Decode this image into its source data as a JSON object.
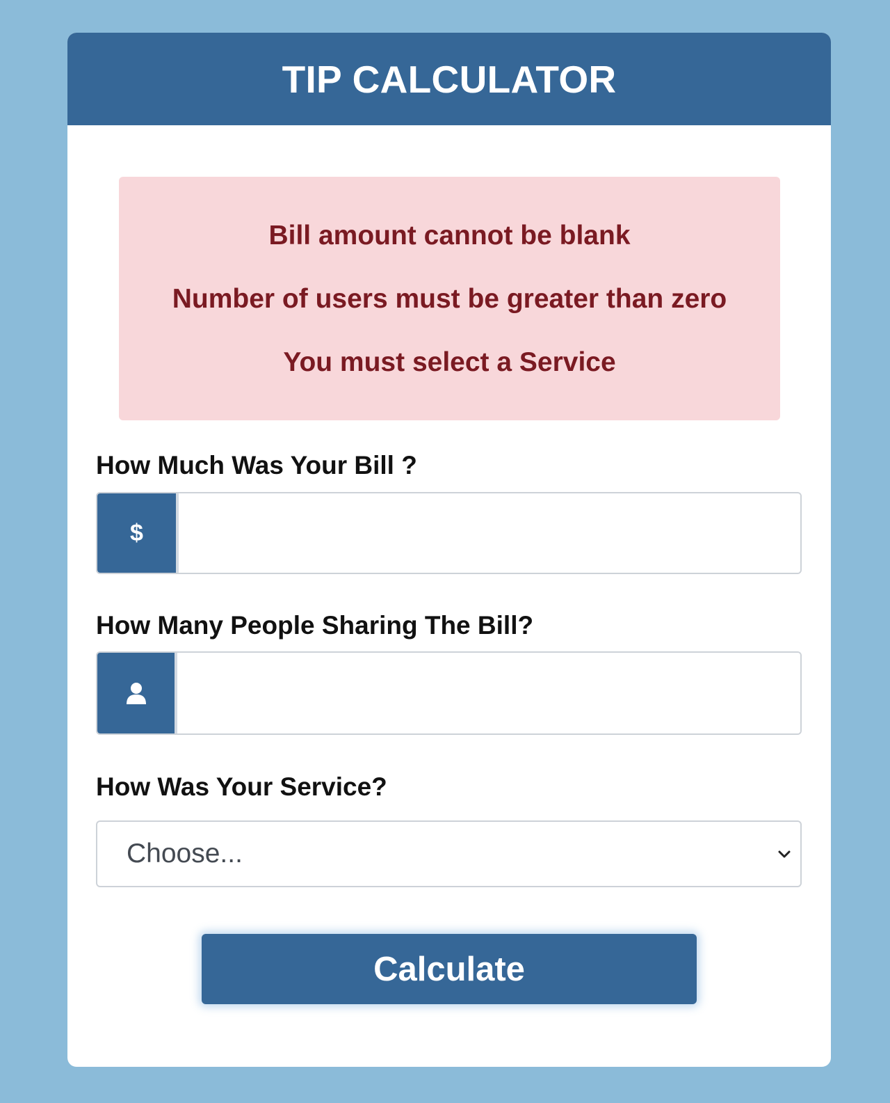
{
  "header": {
    "title": "TIP CALCULATOR"
  },
  "alert": {
    "messages": [
      "Bill amount cannot be blank",
      "Number of users must be greater than zero",
      "You must select a Service"
    ]
  },
  "bill": {
    "label": "How Much Was Your Bill ?",
    "addon_text": "$",
    "value": ""
  },
  "people": {
    "label": "How Many People Sharing The Bill?",
    "icon": "user-icon",
    "value": ""
  },
  "service": {
    "label": "How Was Your Service?",
    "selected": "Choose..."
  },
  "button": {
    "label": "Calculate"
  },
  "colors": {
    "page_background": "#8bbbd9",
    "brand": "#366797",
    "alert_background": "#f8d7da",
    "alert_text": "#7a1a22"
  }
}
